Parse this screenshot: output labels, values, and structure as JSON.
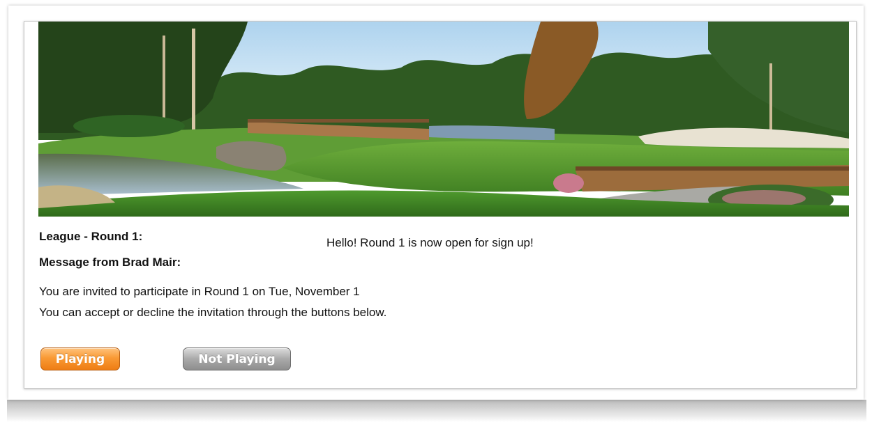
{
  "invitation": {
    "league_label": "League - Round 1:",
    "message_label": "Message from Brad Mair:",
    "message_text": "Hello! Round 1 is now open for sign up!",
    "invite_line1": "You are invited to participate in Round 1 on Tue, November 1",
    "invite_line2": "You can accept or decline the invitation through the buttons below."
  },
  "actions": {
    "playing_label": "Playing",
    "not_playing_label": "Not Playing"
  },
  "colors": {
    "playing_button": "#f39325",
    "not_playing_button": "#a0a0a0",
    "text": "#111111"
  }
}
